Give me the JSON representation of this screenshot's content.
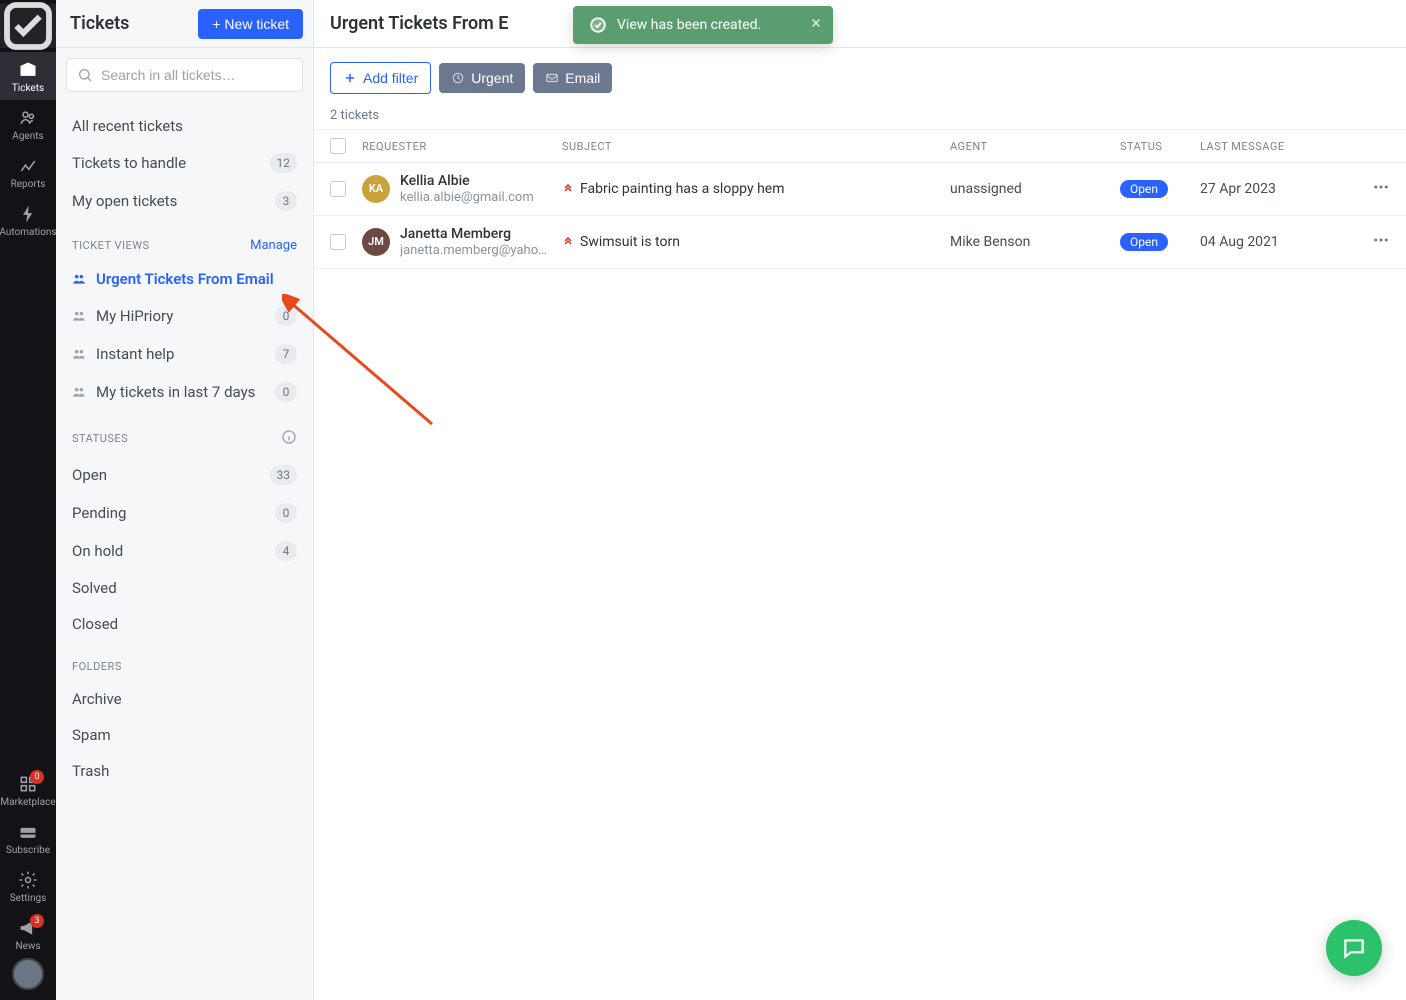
{
  "rail": {
    "items_top": [
      {
        "name": "tickets",
        "label": "Tickets",
        "active": true
      },
      {
        "name": "agents",
        "label": "Agents"
      },
      {
        "name": "reports",
        "label": "Reports"
      },
      {
        "name": "automations",
        "label": "Automations"
      }
    ],
    "items_bottom": [
      {
        "name": "marketplace",
        "label": "Marketplace",
        "badge": "0"
      },
      {
        "name": "subscribe",
        "label": "Subscribe"
      },
      {
        "name": "settings",
        "label": "Settings"
      },
      {
        "name": "news",
        "label": "News",
        "badge": "3"
      }
    ]
  },
  "sidebar": {
    "title": "Tickets",
    "new_ticket_btn": "+ New ticket",
    "search_placeholder": "Search in all tickets…",
    "nav_primary": [
      {
        "label": "All recent tickets",
        "count": null
      },
      {
        "label": "Tickets to handle",
        "count": "12"
      },
      {
        "label": "My open tickets",
        "count": "3"
      }
    ],
    "views_header": "TICKET VIEWS",
    "views_manage": "Manage",
    "views": [
      {
        "label": "Urgent Tickets From Email",
        "selected": true,
        "count": null
      },
      {
        "label": "My HiPriory",
        "count": "0"
      },
      {
        "label": "Instant help",
        "count": "7"
      },
      {
        "label": "My tickets in last 7 days",
        "count": "0"
      }
    ],
    "statuses_header": "STATUSES",
    "statuses": [
      {
        "label": "Open",
        "count": "33"
      },
      {
        "label": "Pending",
        "count": "0"
      },
      {
        "label": "On hold",
        "count": "4"
      },
      {
        "label": "Solved",
        "count": null
      },
      {
        "label": "Closed",
        "count": null
      }
    ],
    "folders_header": "FOLDERS",
    "folders": [
      {
        "label": "Archive"
      },
      {
        "label": "Spam"
      },
      {
        "label": "Trash"
      }
    ]
  },
  "main": {
    "title": "Urgent Tickets From E",
    "add_filter": "Add filter",
    "chips": [
      "Urgent",
      "Email"
    ],
    "count_label": "2 tickets",
    "columns": {
      "requester": "REQUESTER",
      "subject": "SUBJECT",
      "agent": "AGENT",
      "status": "STATUS",
      "last": "LAST MESSAGE"
    },
    "rows": [
      {
        "initials": "KA",
        "avatar_color": "#c9a23b",
        "name": "Kellia Albie",
        "email": "kellia.albie@gmail.com",
        "subject": "Fabric painting has a sloppy hem",
        "agent": "unassigned",
        "status": "Open",
        "last": "27 Apr 2023"
      },
      {
        "initials": "JM",
        "avatar_color": "#6d4a42",
        "name": "Janetta Memberg",
        "email": "janetta.memberg@yaho…",
        "subject": "Swimsuit is torn",
        "agent": "Mike Benson",
        "status": "Open",
        "last": "04 Aug 2021"
      }
    ]
  },
  "toast": {
    "message": "View has been created."
  }
}
